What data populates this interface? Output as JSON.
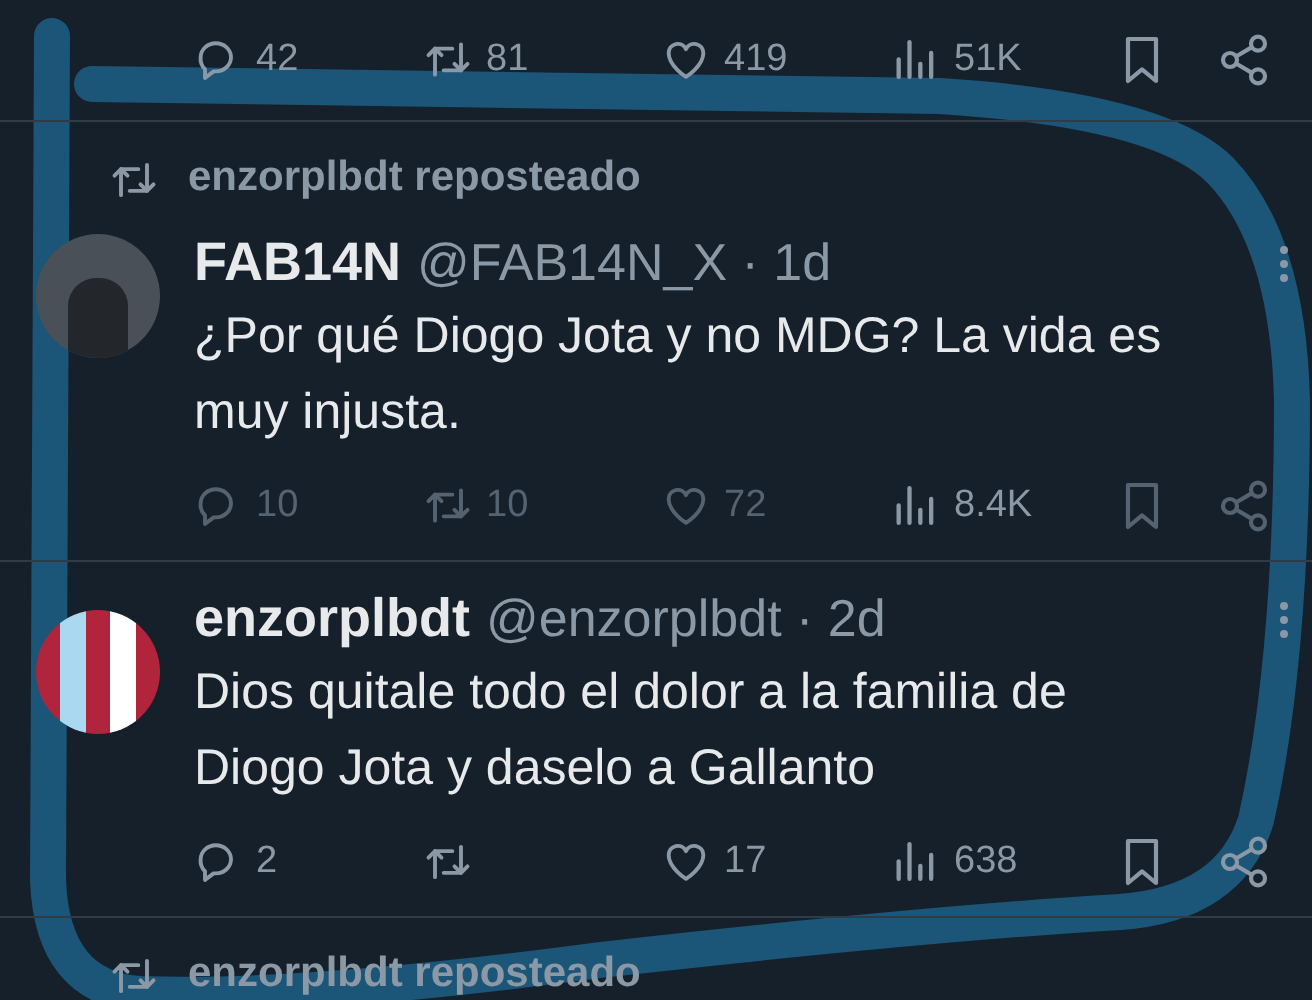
{
  "top_actions": {
    "reply": "42",
    "repost": "81",
    "like": "419",
    "views": "51K"
  },
  "posts": [
    {
      "reposted_by": "enzorplbdt reposteado",
      "avatar": {
        "kind": "photo"
      },
      "name": "FAB14N",
      "meta": "@FAB14N_X · 1d",
      "text": "¿Por qué Diogo Jota y no MDG? La vida es muy injusta.",
      "actions": {
        "reply": "10",
        "repost": "10",
        "like": "72",
        "views": "8.4K"
      },
      "dimmed": true
    },
    {
      "avatar": {
        "kind": "stripes"
      },
      "name": "enzorplbdt",
      "meta": "@enzorplbdt · 2d",
      "text": "Dios quitale todo el dolor a la familia de Diogo Jota y daselo a Gallanto",
      "actions": {
        "reply": "2",
        "like": "17",
        "views": "638"
      },
      "dimmed": false
    }
  ],
  "bottom_repost": "enzorplbdt reposteado"
}
